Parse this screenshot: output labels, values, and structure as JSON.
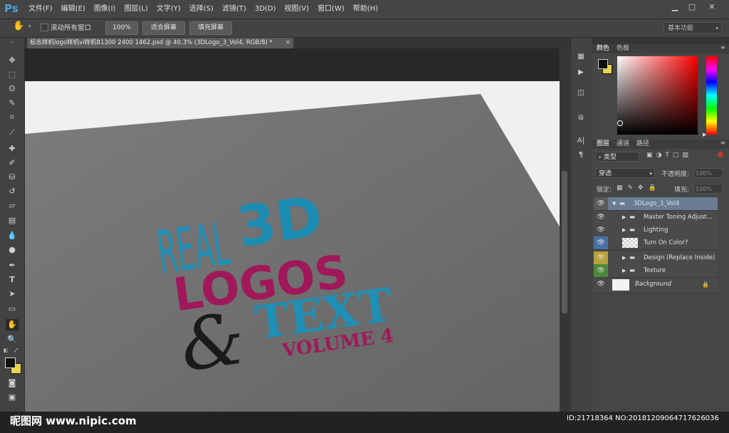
{
  "app": {
    "logo": "Ps",
    "menus": [
      "文件(F)",
      "编辑(E)",
      "图像(I)",
      "图层(L)",
      "文字(Y)",
      "选择(S)",
      "滤镜(T)",
      "3D(D)",
      "视图(V)",
      "窗口(W)",
      "帮助(H)"
    ]
  },
  "options": {
    "scroll_all": "滚动所有窗口",
    "zoom100": "100%",
    "fit_screen": "适合屏幕",
    "fill_screen": "填充屏幕",
    "workspace": "基本功能"
  },
  "document": {
    "tab_title": "标志样机logo样机vi样机81300 2400 1462.psd @ 40.3% (3DLogo_3_Vol4, RGB/8) *",
    "close": "×"
  },
  "artwork": {
    "real": "REAL",
    "three_d": "3D",
    "logos": "LOGOS",
    "amp": "&",
    "text": "TEXT",
    "volume": "VOLUME 4"
  },
  "colors": {
    "accent": "#4aa3df",
    "teal": "#1f8fb5",
    "magenta": "#a0185a",
    "paper": "#6b6b6b"
  },
  "panels": {
    "color_tabs": [
      "颜色",
      "色板"
    ],
    "layer_tabs": [
      "图层",
      "通道",
      "路径"
    ],
    "kind_filter": "类型",
    "blend_mode": "穿透",
    "opacity_label": "不透明度:",
    "opacity_value": "100%",
    "lock_label": "锁定:",
    "fill_label": "填充:",
    "fill_value": "100%"
  },
  "layers": [
    {
      "name": "3DLogo_3_Vol4",
      "type": "group-open",
      "eye": "#5a5a5a"
    },
    {
      "name": "Master Toning Adjust...",
      "type": "group",
      "eye": ""
    },
    {
      "name": "Lighting",
      "type": "group",
      "eye": ""
    },
    {
      "name": "Turn On Color?",
      "type": "smart",
      "eye": "#4a6fa5"
    },
    {
      "name": "Design (Replace Inside)",
      "type": "group",
      "eye": "#b8a23a"
    },
    {
      "name": "Texture",
      "type": "group",
      "eye": "#4a8a3a"
    },
    {
      "name": "Background",
      "type": "background",
      "eye": ""
    }
  ],
  "watermark": {
    "left": "昵图网 www.nipic.com",
    "right": "ID:21718364 NO:20181209064717626036"
  }
}
